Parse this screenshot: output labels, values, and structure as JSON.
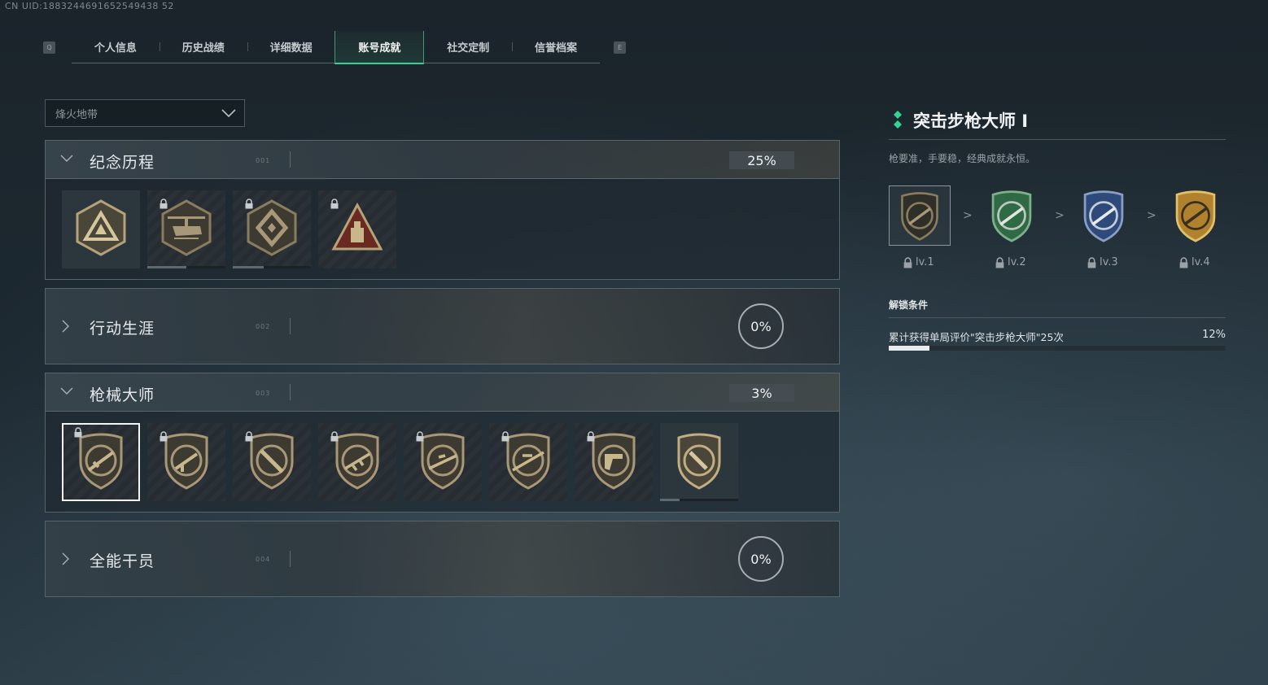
{
  "uid_text": "CN UID:1883244691652549438 52",
  "tabs": {
    "left_key": "Q",
    "right_key": "E",
    "items": [
      {
        "label": "个人信息"
      },
      {
        "label": "历史战绩"
      },
      {
        "label": "详细数据"
      },
      {
        "label": "账号成就",
        "active": true
      },
      {
        "label": "社交定制"
      },
      {
        "label": "信誉档案"
      }
    ]
  },
  "mode_select": {
    "value": "烽火地带"
  },
  "sections": [
    {
      "title": "纪念历程",
      "number": "001",
      "progress": "25%",
      "expanded": true,
      "badges": [
        {
          "icon": "triangle-emblem-icon",
          "locked": false,
          "progress": 0
        },
        {
          "icon": "helicopter-emblem-icon",
          "locked": true,
          "progress": 0.5
        },
        {
          "icon": "diamond-emblem-icon",
          "locked": true,
          "progress": 0.4
        },
        {
          "icon": "red-triangle-emblem-icon",
          "locked": true,
          "progress": 0
        }
      ]
    },
    {
      "title": "行动生涯",
      "number": "002",
      "progress": "0%",
      "expanded": false
    },
    {
      "title": "枪械大师",
      "number": "003",
      "progress": "3%",
      "expanded": true,
      "badges": [
        {
          "icon": "assault-rifle-shield-icon",
          "locked": true,
          "selected": true,
          "progress": 0
        },
        {
          "icon": "smg-shield-icon",
          "locked": true,
          "progress": 0
        },
        {
          "icon": "shotgun-shield-icon",
          "locked": true,
          "progress": 0
        },
        {
          "icon": "lmg-shield-icon",
          "locked": true,
          "progress": 0
        },
        {
          "icon": "marksman-rifle-shield-icon",
          "locked": true,
          "progress": 0
        },
        {
          "icon": "sniper-rifle-shield-icon",
          "locked": true,
          "progress": 0
        },
        {
          "icon": "pistol-shield-icon",
          "locked": true,
          "progress": 0
        },
        {
          "icon": "melee-shield-icon",
          "locked": false,
          "progress": 0.25
        }
      ]
    },
    {
      "title": "全能干员",
      "number": "004",
      "progress": "0%",
      "expanded": false
    }
  ],
  "detail": {
    "title": "突击步枪大师 I",
    "description": "枪要准，手要稳，经典成就永恒。",
    "levels": [
      {
        "label": "lv.1",
        "color": "#2f2f2a"
      },
      {
        "label": "lv.2",
        "color": "#2f6a45"
      },
      {
        "label": "lv.3",
        "color": "#2d4a7a"
      },
      {
        "label": "lv.4",
        "color": "#b0822d"
      }
    ],
    "level_arrow": ">",
    "unlock_heading": "解锁条件",
    "condition_text": "累计获得单局评价\"突击步枪大师\"25次",
    "condition_progress": "12%",
    "condition_fraction": 0.12
  },
  "colors": {
    "accent": "#2fd693",
    "badge_gold": "#b5a27a"
  }
}
